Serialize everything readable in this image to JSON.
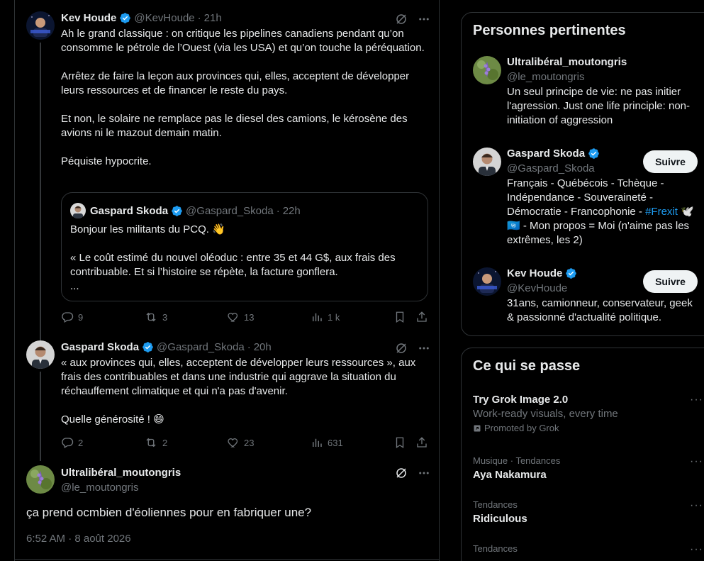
{
  "colors": {
    "background": "#000000",
    "text": "#e7e9ea",
    "muted": "#71767b",
    "accent": "#1d9bf0",
    "border": "#2f3336"
  },
  "thread": {
    "tweet1": {
      "name": "Kev Houde",
      "handle": "@KevHoude",
      "dot": "·",
      "time": "21h",
      "text": "Ah le grand classique : on critique les pipelines canadiens pendant qu’on consomme le pétrole de l’Ouest (via les USA) et qu’on touche la péréquation.\n\nArrêtez de faire la leçon aux provinces qui, elles, acceptent de développer leurs ressources et de financer le reste du pays.\n\nEt non, le solaire ne remplace pas le diesel des camions, le kérosène des avions ni le mazout demain matin.\n\nPéquiste hypocrite.",
      "quote": {
        "name": "Gaspard Skoda",
        "handle": "@Gaspard_Skoda",
        "dot": "·",
        "time": "22h",
        "text": "Bonjour les militants du PCQ. 👋\n\n« Le coût estimé du nouvel oléoduc : entre 35 et 44 G$, aux frais des contribuable. Et si l’histoire se répète, la facture gonflera.\n..."
      },
      "replies": "9",
      "reposts": "3",
      "likes": "13",
      "views": "1 k"
    },
    "tweet2": {
      "name": "Gaspard Skoda",
      "handle": "@Gaspard_Skoda",
      "dot": "·",
      "time": "20h",
      "text": "« aux provinces qui, elles, acceptent de développer leurs ressources », aux frais des contribuables et dans une industrie qui aggrave la situation du réchauffement climatique et qui n'a pas d'avenir.\n\nQuelle générosité ! 😄",
      "replies": "2",
      "reposts": "2",
      "likes": "23",
      "views": "631"
    },
    "focus": {
      "name": "Ultralibéral_moutongris",
      "handle": "@le_moutongris",
      "text": "ça prend ocmbien d'éoliennes pour en fabriquer une?",
      "timestamp": "6:52 AM · 8 août 2026"
    }
  },
  "relevant": {
    "title": "Personnes pertinentes",
    "people": [
      {
        "name": "Ultralibéral_moutongris",
        "handle": "@le_moutongris",
        "bio": "Un seul principe de vie: ne pas initier l'agression. Just one life principle: non-initiation of aggression"
      },
      {
        "name": "Gaspard Skoda",
        "handle": "@Gaspard_Skoda",
        "bio_pre": "Français - Québécois - Tchèque - Indépendance - Souveraineté - Démocratie - Francophonie - ",
        "bio_link": "#Frexit",
        "bio_post": " 🕊️🇺🇳 - Mon propos = Moi (n'aime pas les extrêmes, les 2)",
        "follow": "Suivre"
      },
      {
        "name": "Kev Houde",
        "handle": "@KevHoude",
        "bio": "31ans, camionneur, conservateur, geek & passionné d'actualité politique.",
        "follow": "Suivre"
      }
    ]
  },
  "happening": {
    "title": "Ce qui se passe",
    "trends": [
      {
        "title": "Try Grok Image 2.0",
        "sub": "Work-ready visuals, every time",
        "promo": "Promoted by Grok"
      },
      {
        "category": "Musique · Tendances",
        "title": "Aya Nakamura"
      },
      {
        "category": "Tendances",
        "title": "Ridiculous"
      },
      {
        "category": "Tendances",
        "title": ""
      }
    ],
    "more": "···"
  }
}
